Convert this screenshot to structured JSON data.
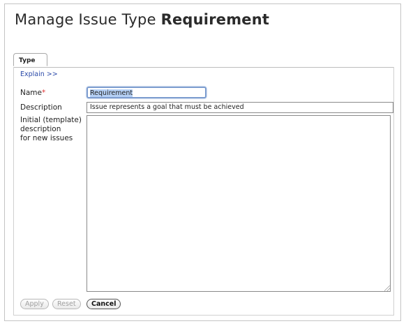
{
  "page": {
    "title_prefix": "Manage Issue Type",
    "title_name": "Requirement"
  },
  "tabs": [
    {
      "label": "Type"
    }
  ],
  "explain_link": "Explain >>",
  "form": {
    "name_label": "Name",
    "name_required_mark": "*",
    "name_value": "Requirement",
    "description_label": "Description",
    "description_value": "Issue represents a goal that must be achieved",
    "template_label_line1": "Initial (template)",
    "template_label_line2": "description",
    "template_label_line3": "for new issues",
    "template_value": ""
  },
  "buttons": {
    "apply": "Apply",
    "reset": "Reset",
    "cancel": "Cancel"
  }
}
